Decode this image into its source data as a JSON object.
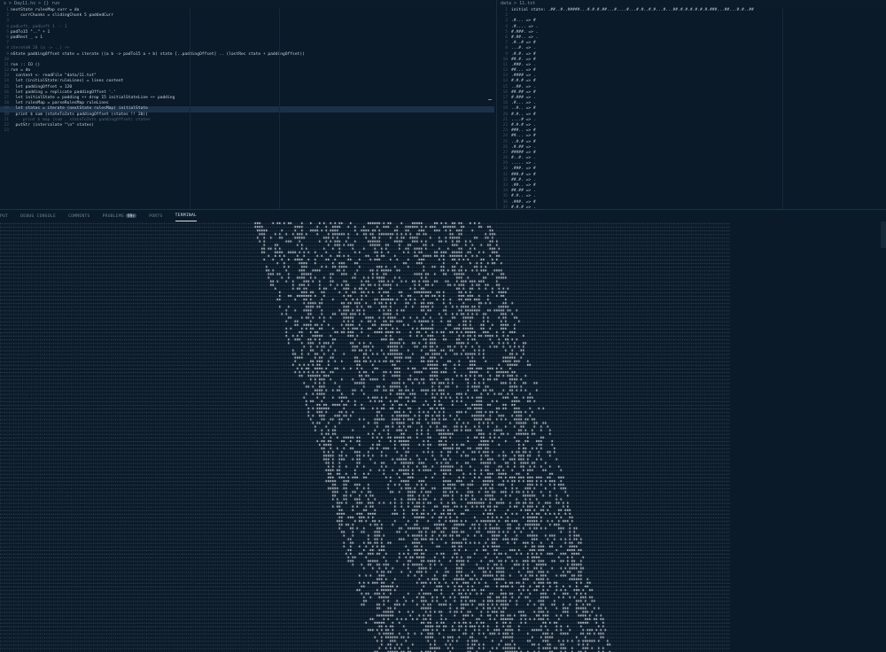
{
  "left_editor": {
    "breadcrumb": [
      "s",
      ">",
      "Day11.hs",
      ">",
      "{} run"
    ],
    "lines": [
      {
        "n": "",
        "t": "nextState rulesMap curr = do"
      },
      {
        "n": "",
        "t": "    currChunks = slidingChunk 5 paddedCurr"
      },
      {
        "n": "",
        "t": ""
      },
      {
        "n": "",
        "t": "",
        "c": "padLeft, padLeft 1 -- 1"
      },
      {
        "n": "",
        "t": "padTo15 \"..\" + 1"
      },
      {
        "n": "",
        "t": "padRest _ = 1"
      },
      {
        "n": "",
        "t": ""
      },
      {
        "n": "",
        "t": "",
        "c": "iterateN 20 (a -> ..) ++"
      },
      {
        "n": "",
        "t": "nState paddingOffset state = iterate ((a b -> padTo15 a + b) state [..paddingOffset] .. (lastRec state + paddingOffset))"
      },
      {
        "n": "",
        "t": ""
      },
      {
        "n": "",
        "t": "run :: IO ()"
      },
      {
        "n": "",
        "t": "run = do"
      },
      {
        "n": "",
        "t": "  content <- readFile \"data/11.txt\""
      },
      {
        "n": "",
        "t": "  let (initialState:ruleLines) = lines content"
      },
      {
        "n": "",
        "t": "  let paddingOffset = 120"
      },
      {
        "n": "",
        "t": "  let padding = replicate paddingOffset '.'"
      },
      {
        "n": "",
        "t": "  let initialState = padding ++ drop 15 initialStateLine ++ padding"
      },
      {
        "n": "",
        "t": "  let rulesMap = parseRulesMap ruleLines"
      },
      {
        "n": "",
        "t": "  let states = iterate (nextState rulesMap) initialState",
        "h": true
      },
      {
        "n": "",
        "t": "  print $ sum (stateToInts paddingOffset (states !! 20))"
      },
      {
        "n": "",
        "t": "",
        "c": "  -- print $ map (sum . stateToInts paddingOffset) states"
      },
      {
        "n": "",
        "t": "  putStr (intercalate \"\\n\" states)"
      },
      {
        "n": "",
        "t": ""
      }
    ]
  },
  "right_editor": {
    "breadcrumb": [
      "data",
      ">",
      "11.txt"
    ],
    "lines": [
      "initial state: .##..#..#####...#.#.#.##...#....#...#.#..#.#...#...##.#.#.#.#.#.#.###...##...#.#..##",
      "",
      ".#... => #",
      ".#.... => .",
      "#.###. => .",
      "#.##.. => .",
      ".#..# => #",
      "...#. => .",
      ".#.#. => #",
      "##.#. => #",
      ".###. => .",
      "##... => #",
      ".#### => .",
      "#.#.# => #",
      "..##. => .",
      "##.## => #",
      "#.### => .",
      ".#... => .",
      "..#.. => #",
      "#.#.. => #",
      "....# => .",
      "#.#.# => .",
      "###.. => #",
      "##... => #",
      "..#.# => #",
      ".#.## => .",
      "##### => #",
      "#..#. => .",
      "..... => .",
      ".###. => #",
      "###.# => #",
      "##.#. => .",
      ".##.. => #",
      "##.## => .",
      "#.#.. => .",
      ".###. => #",
      "#.#.# => .",
      "..#.# => #",
      ".##.. => ."
    ]
  },
  "panel": {
    "tabs": [
      "PUT",
      "DEBUG CONSOLE",
      "COMMENTS",
      "PROBLEMS",
      "PORTS",
      "TERMINAL"
    ],
    "problems_count": "99+",
    "active_tab": "TERMINAL"
  },
  "colors": {
    "background": "#0b1a28",
    "terminal_text": "#cfd9e2",
    "accent_highlight": "#1a3148"
  },
  "icons": {
    "chevron": "chevron-right-icon",
    "file": "file-icon"
  }
}
